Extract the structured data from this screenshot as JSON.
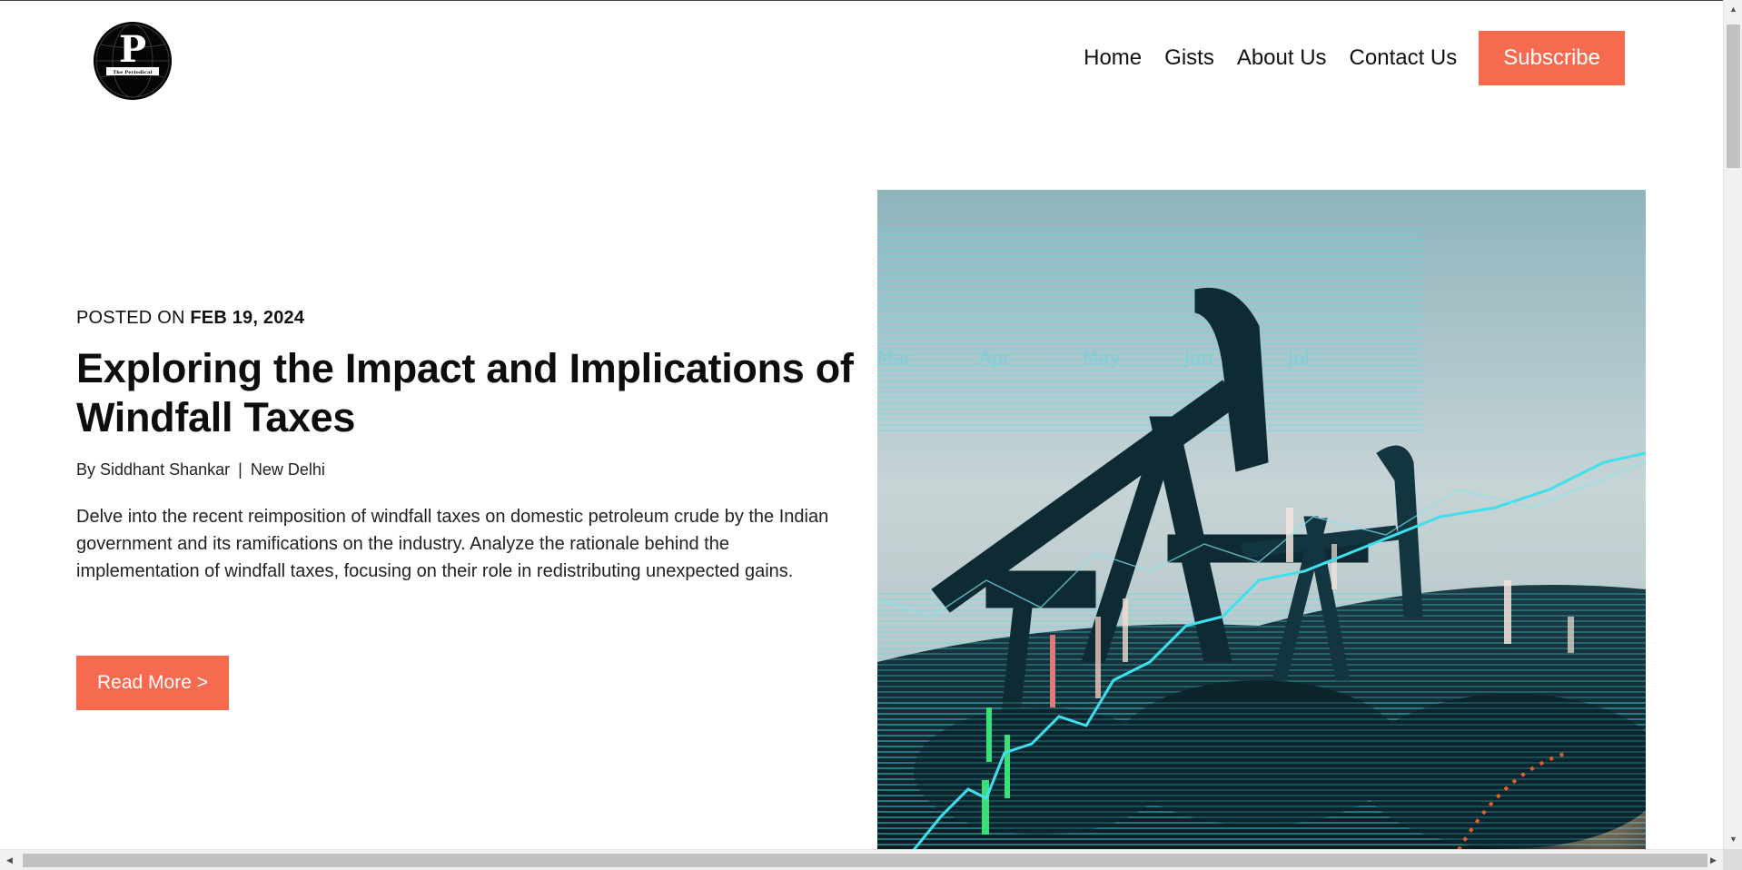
{
  "header": {
    "logo_letter": "P",
    "logo_caption": "The Periodical",
    "nav": [
      "Home",
      "Gists",
      "About Us",
      "Contact Us"
    ],
    "subscribe_label": "Subscribe"
  },
  "article": {
    "posted_prefix": "POSTED ON",
    "posted_date": "FEB 19, 2024",
    "title": "Exploring the Impact and Implications of Windfall Taxes",
    "author": "By Siddhant Shankar",
    "separator": "|",
    "location": "New Delhi",
    "excerpt": "Delve into the recent reimposition of windfall taxes on domestic petroleum crude by the Indian government and its ramifications on the industry. Analyze the rationale behind the implementation of windfall taxes, focusing on their role in redistributing unexpected gains.",
    "read_more_label": "Read More >"
  },
  "hero_image": {
    "subject": "oil-pumpjacks-with-stock-chart-overlay",
    "month_labels": [
      "Mar",
      "Apr",
      "May",
      "Jun",
      "Jul"
    ]
  },
  "colors": {
    "accent": "#f66b4f",
    "text": "#111111",
    "overlay_cyan": "#35d3e0"
  }
}
